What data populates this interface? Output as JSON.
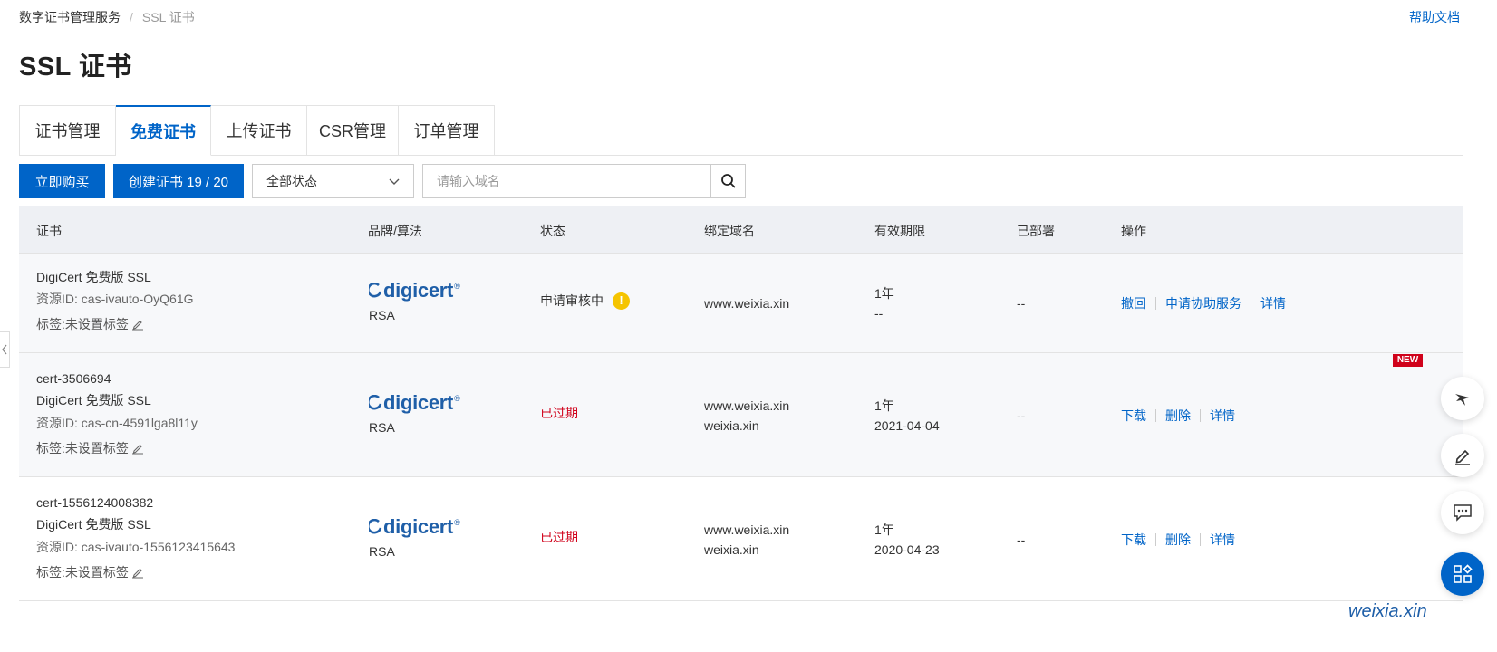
{
  "breadcrumb": {
    "parent": "数字证书管理服务",
    "current": "SSL 证书"
  },
  "help": "帮助文档",
  "title": "SSL 证书",
  "tabs": [
    "证书管理",
    "免费证书",
    "上传证书",
    "CSR管理",
    "订单管理"
  ],
  "toolbar": {
    "buy": "立即购买",
    "create": "创建证书 19 / 20",
    "status_filter": "全部状态",
    "search_placeholder": "请输入域名"
  },
  "columns": [
    "证书",
    "品牌/算法",
    "状态",
    "绑定域名",
    "有效期限",
    "已部署",
    "操作"
  ],
  "rows": [
    {
      "name": "",
      "product": "DigiCert 免费版 SSL",
      "resource": "资源ID: cas-ivauto-OyQ61G",
      "tag": "标签:未设置标签",
      "brand": "digicert",
      "algo": "RSA",
      "status": "申请审核中",
      "domains": [
        "www.weixia.xin"
      ],
      "validity": "1年",
      "expiry": "--",
      "deployed": "--",
      "ops": [
        "撤回",
        "申请协助服务",
        "详情"
      ]
    },
    {
      "name": "cert-3506694",
      "product": "DigiCert 免费版 SSL",
      "resource": "资源ID: cas-cn-4591lga8l11y",
      "tag": "标签:未设置标签",
      "brand": "digicert",
      "algo": "RSA",
      "status": "已过期",
      "domains": [
        "www.weixia.xin",
        "weixia.xin"
      ],
      "validity": "1年",
      "expiry": "2021-04-04",
      "deployed": "--",
      "ops": [
        "下载",
        "删除",
        "详情"
      ]
    },
    {
      "name": "cert-1556124008382",
      "product": "DigiCert 免费版 SSL",
      "resource": "资源ID: cas-ivauto-1556123415643",
      "tag": "标签:未设置标签",
      "brand": "digicert",
      "algo": "RSA",
      "status": "已过期",
      "domains": [
        "www.weixia.xin",
        "weixia.xin"
      ],
      "validity": "1年",
      "expiry": "2020-04-23",
      "deployed": "--",
      "ops": [
        "下载",
        "删除",
        "详情"
      ]
    }
  ],
  "floating": {
    "new_badge": "NEW"
  },
  "watermark": "weixia.xin",
  "colors": {
    "primary": "#0064c8",
    "expired": "#d0021b",
    "warning": "#f5c400",
    "brand": "#1f5fa8"
  },
  "icons": [
    "chevron-down-icon",
    "search-icon",
    "edit-icon",
    "warning-icon",
    "chevron-left-icon",
    "feedback-bird-icon",
    "edit-note-icon",
    "chat-icon",
    "apps-icon"
  ]
}
